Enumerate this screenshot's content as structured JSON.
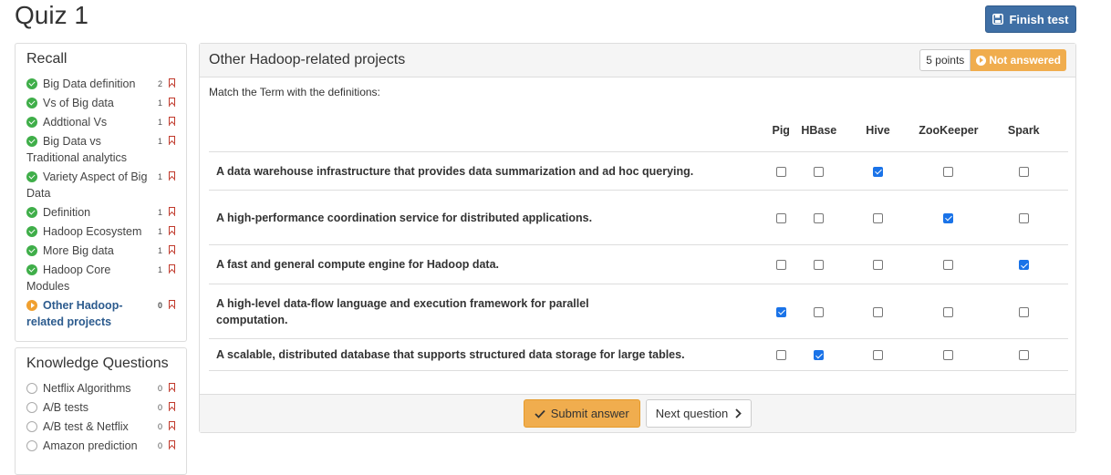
{
  "page": {
    "title": "Quiz 1",
    "finish_label": "Finish test"
  },
  "nav": [
    {
      "title": "Recall",
      "items": [
        {
          "label": "Big Data definition",
          "count": "2",
          "state": "done"
        },
        {
          "label": "Vs of Big data",
          "count": "1",
          "state": "done"
        },
        {
          "label": "Addtional Vs",
          "count": "1",
          "state": "done"
        },
        {
          "label": "Big Data vs Traditional analytics",
          "count": "1",
          "state": "done"
        },
        {
          "label": "Variety Aspect of Big Data",
          "count": "1",
          "state": "done"
        },
        {
          "label": "Definition",
          "count": "1",
          "state": "done"
        },
        {
          "label": "Hadoop Ecosystem",
          "count": "1",
          "state": "done"
        },
        {
          "label": "More Big data",
          "count": "1",
          "state": "done"
        },
        {
          "label": "Hadoop Core Modules",
          "count": "1",
          "state": "done"
        },
        {
          "label": "Other Hadoop-related projects",
          "count": "0",
          "state": "current"
        }
      ]
    },
    {
      "title": "Knowledge Questions",
      "items": [
        {
          "label": "Netflix Algorithms",
          "count": "0",
          "state": "open"
        },
        {
          "label": "A/B tests",
          "count": "0",
          "state": "open"
        },
        {
          "label": "A/B test & Netflix",
          "count": "0",
          "state": "open"
        },
        {
          "label": "Amazon prediction",
          "count": "0",
          "state": "open"
        }
      ]
    }
  ],
  "question": {
    "title": "Other Hadoop-related projects",
    "points": "5 points",
    "status": "Not answered",
    "instruction": "Match the Term with the definitions:",
    "columns": [
      "Pig",
      "HBase",
      "Hive",
      "ZooKeeper",
      "Spark"
    ],
    "rows": [
      {
        "text": "A data warehouse infrastructure that provides data summarization and ad hoc querying.",
        "checked": [
          false,
          false,
          true,
          false,
          false
        ]
      },
      {
        "text": "A high-performance coordination service for distributed applications.",
        "checked": [
          false,
          false,
          false,
          true,
          false
        ]
      },
      {
        "text": "A fast and general compute engine for Hadoop data.",
        "checked": [
          false,
          false,
          false,
          false,
          true
        ]
      },
      {
        "text": "A high-level data-flow language and execution framework for parallel computation.",
        "checked": [
          true,
          false,
          false,
          false,
          false
        ]
      },
      {
        "text": "A scalable, distributed database that supports structured data storage for large tables.",
        "checked": [
          false,
          true,
          false,
          false,
          false
        ]
      }
    ],
    "submit_label": "Submit answer",
    "next_label": "Next question"
  }
}
